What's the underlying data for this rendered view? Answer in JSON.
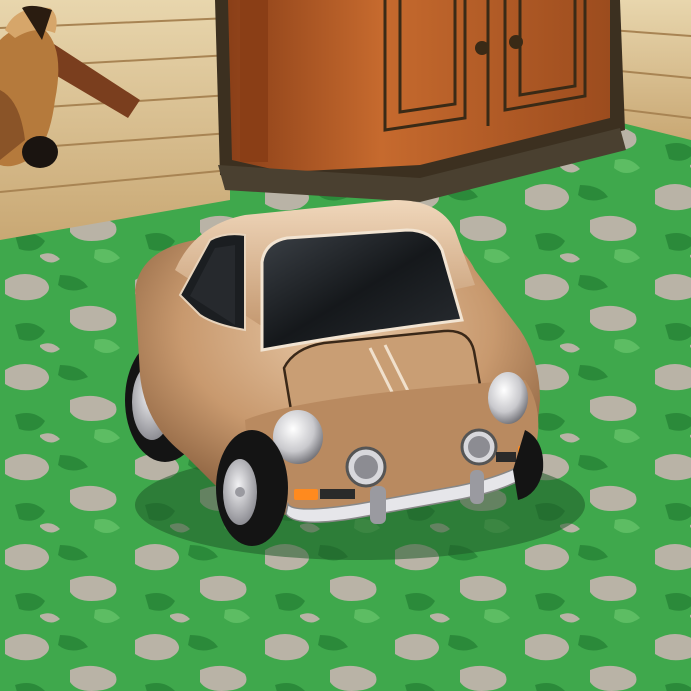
{
  "scene": {
    "type": "3d-game-render",
    "subject": "toy-car",
    "text_visible": []
  },
  "palette": {
    "grass_light": "#4fb85a",
    "grass_dark": "#2c8d3c",
    "camo_gray": "#b8b2a6",
    "car_body": "#c79b74",
    "car_body_light": "#e2c2a0",
    "car_body_shadow": "#8a6040",
    "window": "#1e2124",
    "tire": "#161616",
    "rim": "#cfcfd2",
    "headlight": "#e8e8ea",
    "indicator": "#ff8a1e",
    "wood_wall": "#e0c89a",
    "cabinet_wood": "#b8602a",
    "cabinet_trim": "#4a3a24",
    "deer_fur": "#b57a3c"
  },
  "icons": [
    "car-sprite",
    "deer-head-trophy",
    "wooden-cabinet"
  ]
}
